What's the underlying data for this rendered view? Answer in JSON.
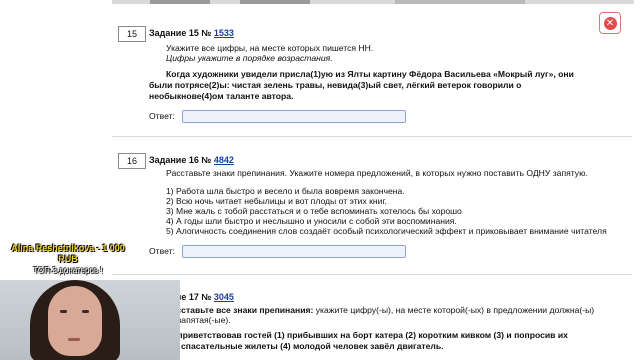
{
  "task15": {
    "num": "15",
    "title_prefix": "Задание 15 №",
    "link": "1533",
    "instruction1": "Укажите все цифры, на месте которых пишется НН.",
    "instruction2": "Цифры укажите в порядке возрастания.",
    "sentence1": "Когда художники увидели присла(1)ую из Ялты картину Фёдора Васильева «Мокрый луг», они",
    "sentence2": "были потрясе(2)ы:  чистая  зелень  травы,  невида(3)ый  свет,  лёгкий  ветерок  говорили  о",
    "sentence3": "необыкнове(4)ом таланте автора.",
    "answer_label": "Ответ:",
    "answer_value": ""
  },
  "task16": {
    "num": "16",
    "title_prefix": "Задание 16 №",
    "link": "4842",
    "instruction": "Расставьте знаки препинания. Укажите номера предложений, в которых нужно поставить ОДНУ запятую.",
    "items": [
      "1) Работа шла быстро и весело и была вовремя закончена.",
      "2) Всю ночь читает небылицы и вот плоды от этих книг.",
      "3) Мне жаль с тобой расстаться и о тебе вспоминать хотелось бы хорошо",
      "4) А годы шли быстро и неслышно и уносили с собой эти воспоминания.",
      "5) Алогичность соединения слов создаёт особый психологический эффект и приковывает внимание читателя"
    ],
    "answer_label": "Ответ:",
    "answer_value": ""
  },
  "task17": {
    "title_prefix": "Задание 17 №",
    "link": "3045",
    "instruction1_bold": "Расставьте все знаки препинания:",
    "instruction1_rest": " укажите цифру(-ы), на месте которой(-ых) в предложении должна(-ы)",
    "instruction2": "стоять запятая(-ые).",
    "sentence1": "Поприветствовав гостей (1) прибывших на борт катера (2) коротким кивком (3) и попросив их",
    "sentence2": "надеть спасательные жилеты (4) молодой человек завёл двигатель."
  },
  "overlay": {
    "donor": "Alina Reshetnikova - 1 000",
    "currency": "RUB",
    "message": "ТОП-3 донатеров !"
  },
  "icons": {
    "close": "close-icon"
  },
  "colors": {
    "link": "#1a3e9c",
    "close_red": "#e64a4a",
    "overlay_yellow": "#f2d23a"
  }
}
